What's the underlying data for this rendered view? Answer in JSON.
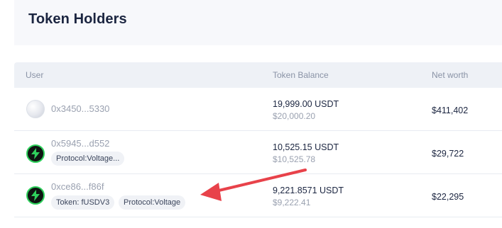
{
  "header": {
    "title": "Token Holders"
  },
  "table": {
    "columns": {
      "user": "User",
      "balance": "Token Balance",
      "networth": "Net worth"
    },
    "rows": [
      {
        "address": "0x3450...5330",
        "tags": [],
        "balance": "19,999.00 USDT",
        "balance_usd": "$20,000.20",
        "networth": "$411,402",
        "avatar": "pearl-orb-icon"
      },
      {
        "address": "0x5945...d552",
        "tags": [
          "Protocol:Voltage..."
        ],
        "balance": "10,525.15 USDT",
        "balance_usd": "$10,525.78",
        "networth": "$29,722",
        "avatar": "voltage-bolt-icon"
      },
      {
        "address": "0xce86...f86f",
        "tags": [
          "Token: fUSDV3",
          "Protocol:Voltage"
        ],
        "balance": "9,221.8571 USDT",
        "balance_usd": "$9,222.41",
        "networth": "$22,295",
        "avatar": "voltage-bolt-icon"
      }
    ]
  },
  "annotation": {
    "arrow_color": "#e8424a",
    "icon": "red-arrow-icon"
  },
  "colors": {
    "voltage_green": "#2fd15c",
    "header_bg": "#f7f8fb",
    "thead_bg": "#eef1f6"
  }
}
